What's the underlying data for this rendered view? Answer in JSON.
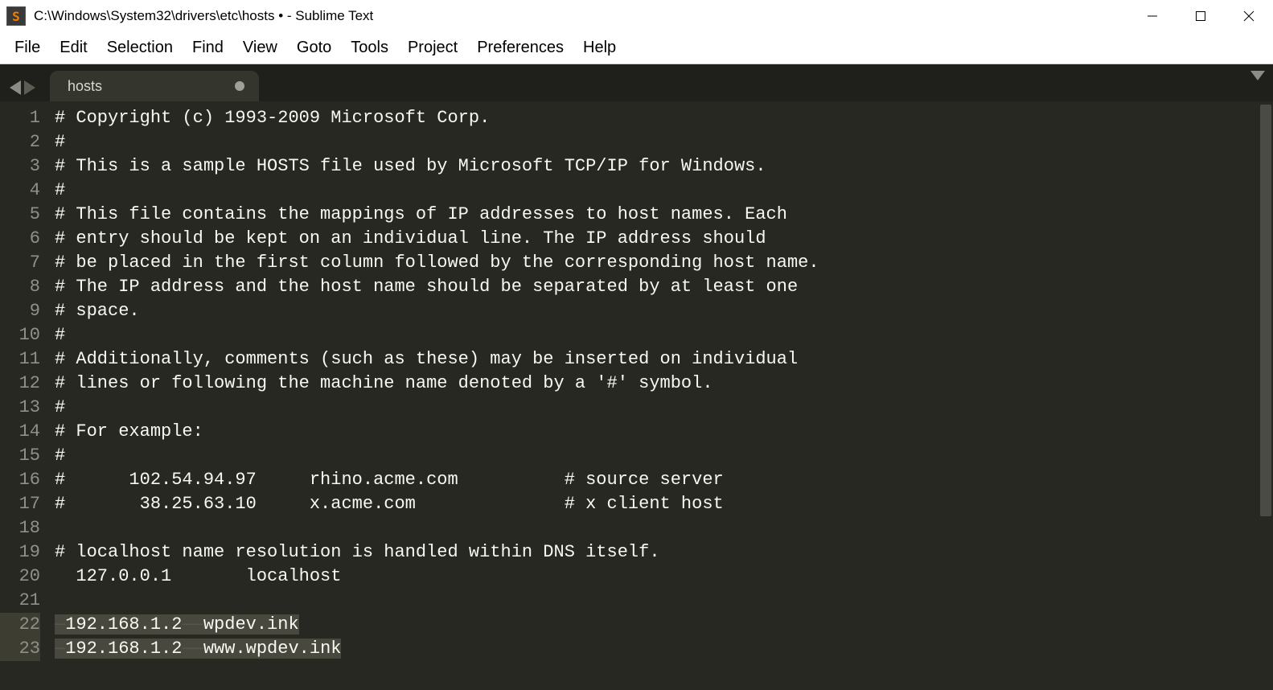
{
  "window": {
    "title": "C:\\Windows\\System32\\drivers\\etc\\hosts • - Sublime Text"
  },
  "menu": {
    "items": [
      "File",
      "Edit",
      "Selection",
      "Find",
      "View",
      "Goto",
      "Tools",
      "Project",
      "Preferences",
      "Help"
    ]
  },
  "tabs": {
    "active": {
      "label": "hosts",
      "dirty": true
    }
  },
  "editor": {
    "lines": [
      "# Copyright (c) 1993-2009 Microsoft Corp.",
      "#",
      "# This is a sample HOSTS file used by Microsoft TCP/IP for Windows.",
      "#",
      "# This file contains the mappings of IP addresses to host names. Each",
      "# entry should be kept on an individual line. The IP address should",
      "# be placed in the first column followed by the corresponding host name.",
      "# The IP address and the host name should be separated by at least one",
      "# space.",
      "#",
      "# Additionally, comments (such as these) may be inserted on individual",
      "# lines or following the machine name denoted by a '#' symbol.",
      "#",
      "# For example:",
      "#",
      "#      102.54.94.97     rhino.acme.com          # source server",
      "#       38.25.63.10     x.acme.com              # x client host",
      "",
      "# localhost name resolution is handled within DNS itself.",
      "  127.0.0.1       localhost",
      "",
      "    192.168.1.2     wpdev.ink",
      "    192.168.1.2     www.wpdev.ink"
    ],
    "highlighted_line_indices": [
      21,
      22
    ],
    "whitespace_marker_lines": [
      21,
      22
    ]
  }
}
